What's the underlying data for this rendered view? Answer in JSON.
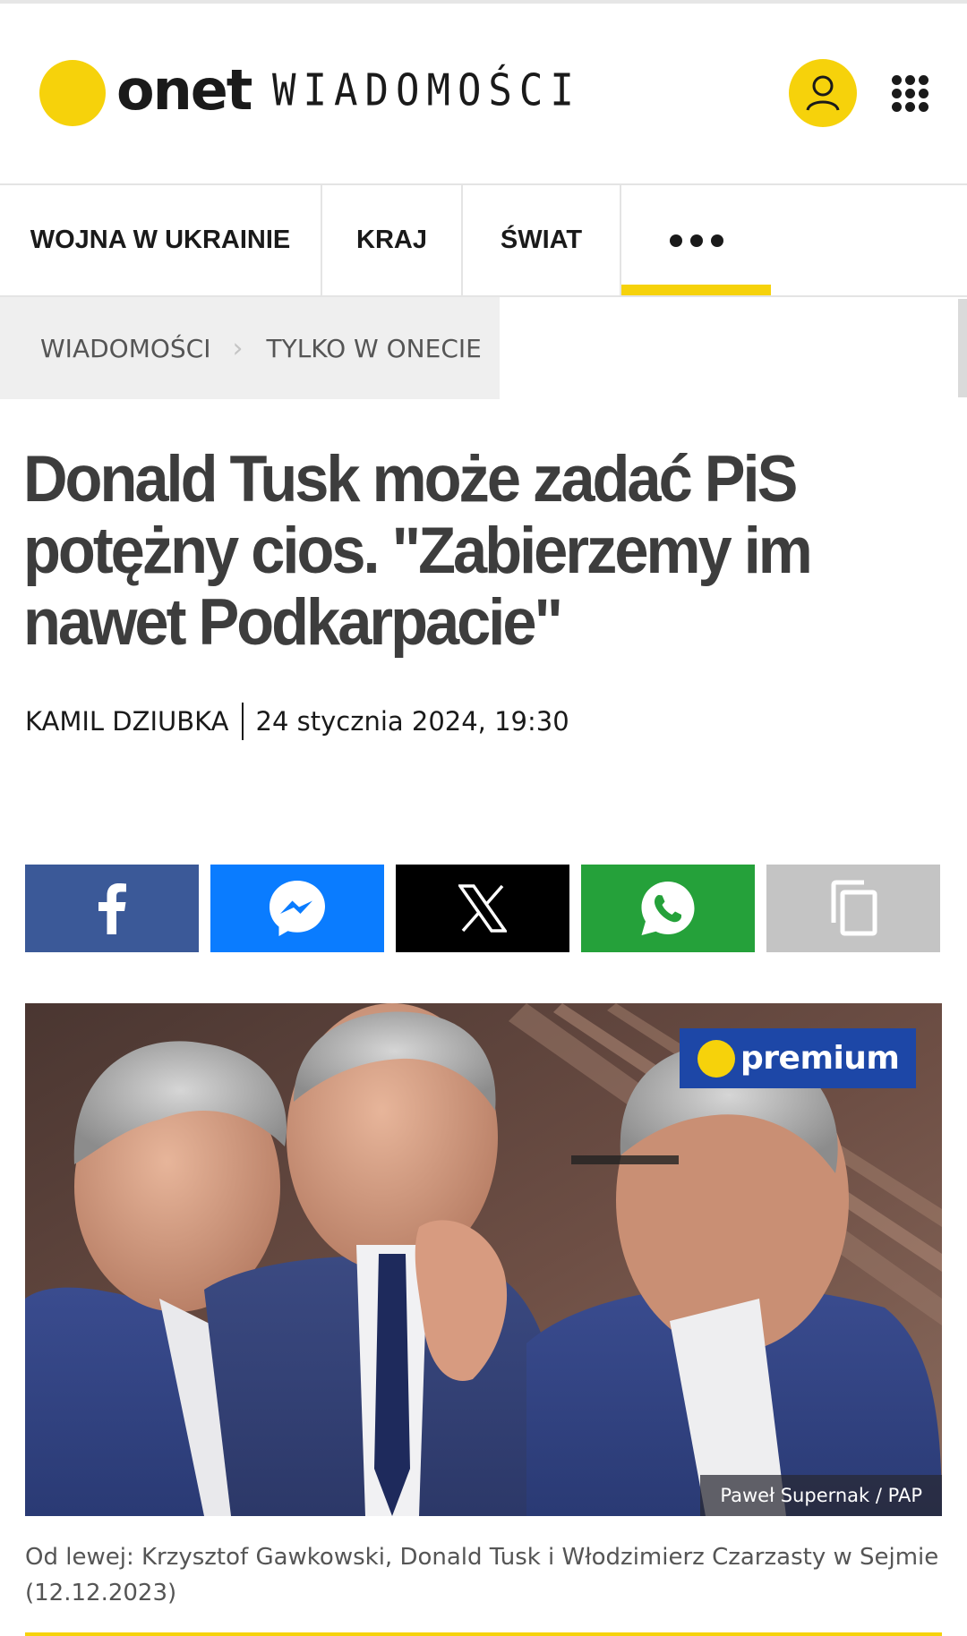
{
  "header": {
    "logo_text": "onet",
    "section_text": "WIADOMOŚCI",
    "user_icon": "user-icon",
    "apps_icon": "apps-grid-icon",
    "brand_color": "#f6d20b"
  },
  "nav": {
    "items": [
      {
        "label": "WOJNA W UKRAINIE"
      },
      {
        "label": "KRAJ"
      },
      {
        "label": "ŚWIAT"
      }
    ],
    "more_icon": "more-dots-icon"
  },
  "breadcrumb": {
    "items": [
      {
        "label": "WIADOMOŚCI"
      },
      {
        "label": "TYLKO W ONECIE"
      }
    ],
    "separator": "›"
  },
  "article": {
    "title": "Donald Tusk może zadać PiS potężny cios. \"Zabierzemy im nawet Podkarpacie\"",
    "author": "KAMIL DZIUBKA",
    "date": "24 stycznia 2024, 19:30"
  },
  "share": {
    "buttons": [
      {
        "icon": "facebook-icon",
        "color": "#3b5998"
      },
      {
        "icon": "messenger-icon",
        "color": "#0a7cff"
      },
      {
        "icon": "x-icon",
        "color": "#000000"
      },
      {
        "icon": "whatsapp-icon",
        "color": "#25a13a"
      },
      {
        "icon": "copy-icon",
        "color": "#c4c4c4"
      }
    ]
  },
  "photo": {
    "badge": "premium",
    "credit": "Paweł Supernak / PAP",
    "caption": "Od lewej: Krzysztof Gawkowski, Donald Tusk i Włodzimierz Czarzasty w Sejmie (12.12.2023)"
  }
}
